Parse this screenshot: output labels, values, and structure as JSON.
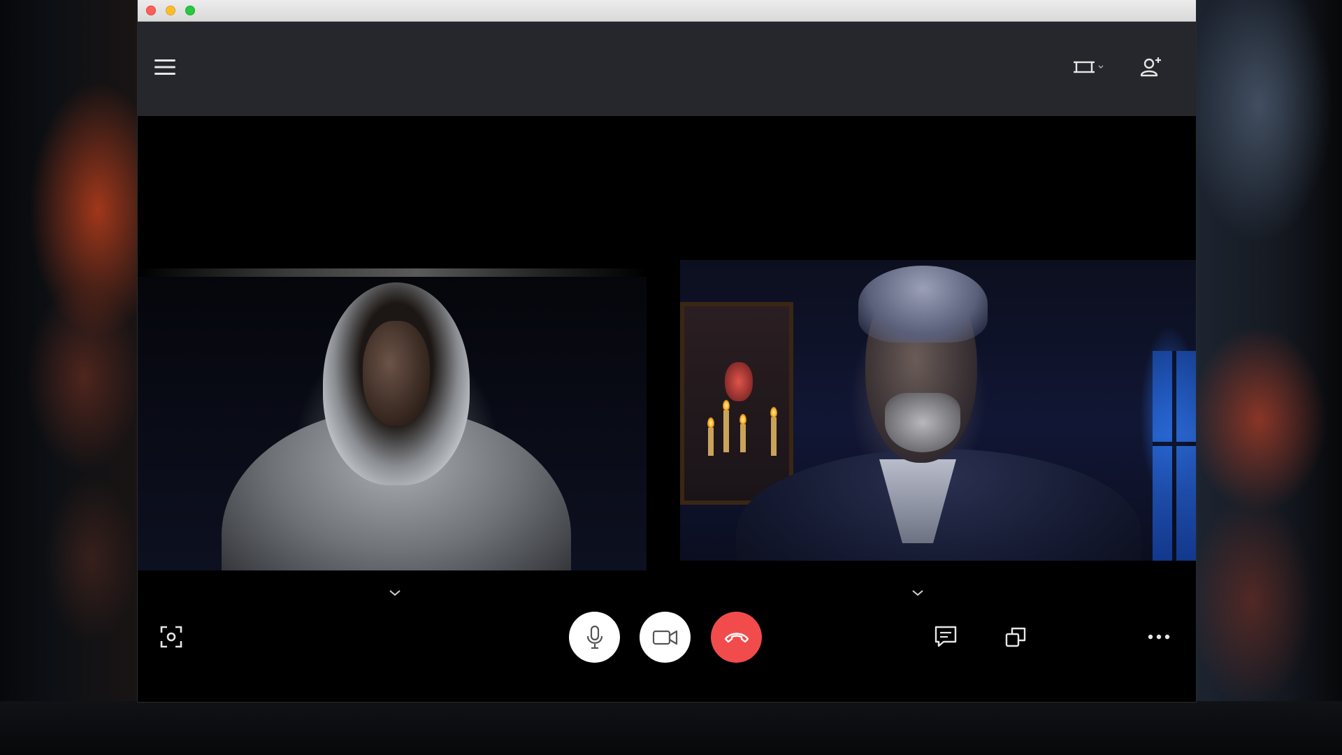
{
  "window": {
    "traffic_lights": [
      {
        "name": "close",
        "color": "#fe5f57"
      },
      {
        "name": "minimize",
        "color": "#febc2e"
      },
      {
        "name": "zoom",
        "color": "#28c840"
      }
    ]
  },
  "header": {
    "left_icon": "hamburger-menu-icon",
    "right_icons": [
      "layout-view-icon",
      "add-participant-icon"
    ]
  },
  "participants": [
    {
      "tile": "left",
      "description_icon": "participant-video",
      "options_icon": "chevron-down-icon"
    },
    {
      "tile": "right",
      "description_icon": "participant-video",
      "options_icon": "chevron-down-icon"
    }
  ],
  "controls": {
    "left": [
      "screenshot-icon"
    ],
    "center": [
      {
        "icon": "microphone-icon",
        "color": "#ffffff"
      },
      {
        "icon": "video-camera-icon",
        "color": "#ffffff"
      },
      {
        "icon": "end-call-icon",
        "color": "#f24b4b"
      }
    ],
    "right": [
      "chat-icon",
      "pop-out-icon",
      "more-options-icon"
    ]
  },
  "colors": {
    "header_bg": "#26272c",
    "stage_bg": "#000000",
    "end_call_red": "#f24b4b",
    "icon_light": "#e6e6e6"
  }
}
